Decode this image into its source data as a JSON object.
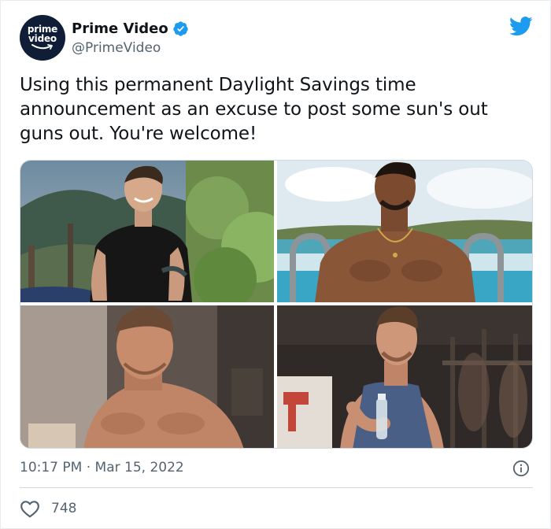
{
  "account": {
    "avatar_text_line1": "prime",
    "avatar_text_line2": "video",
    "name": "Prime Video",
    "handle": "@PrimeVideo",
    "verified": true
  },
  "tweet": {
    "text": "Using this permanent Daylight Savings time announcement as an excuse to post some sun's out guns out. You're welcome!",
    "timestamp": "10:17 PM · Mar 15, 2022"
  },
  "stats": {
    "likes": "748"
  },
  "icons": {
    "platform": "twitter-bird-icon",
    "verified": "verified-badge-icon",
    "info": "info-icon",
    "like": "heart-icon"
  },
  "colors": {
    "twitter_blue": "#1d9bf0",
    "secondary_text": "#536471",
    "primary_text": "#0f1419",
    "divider": "#cfd9de"
  }
}
